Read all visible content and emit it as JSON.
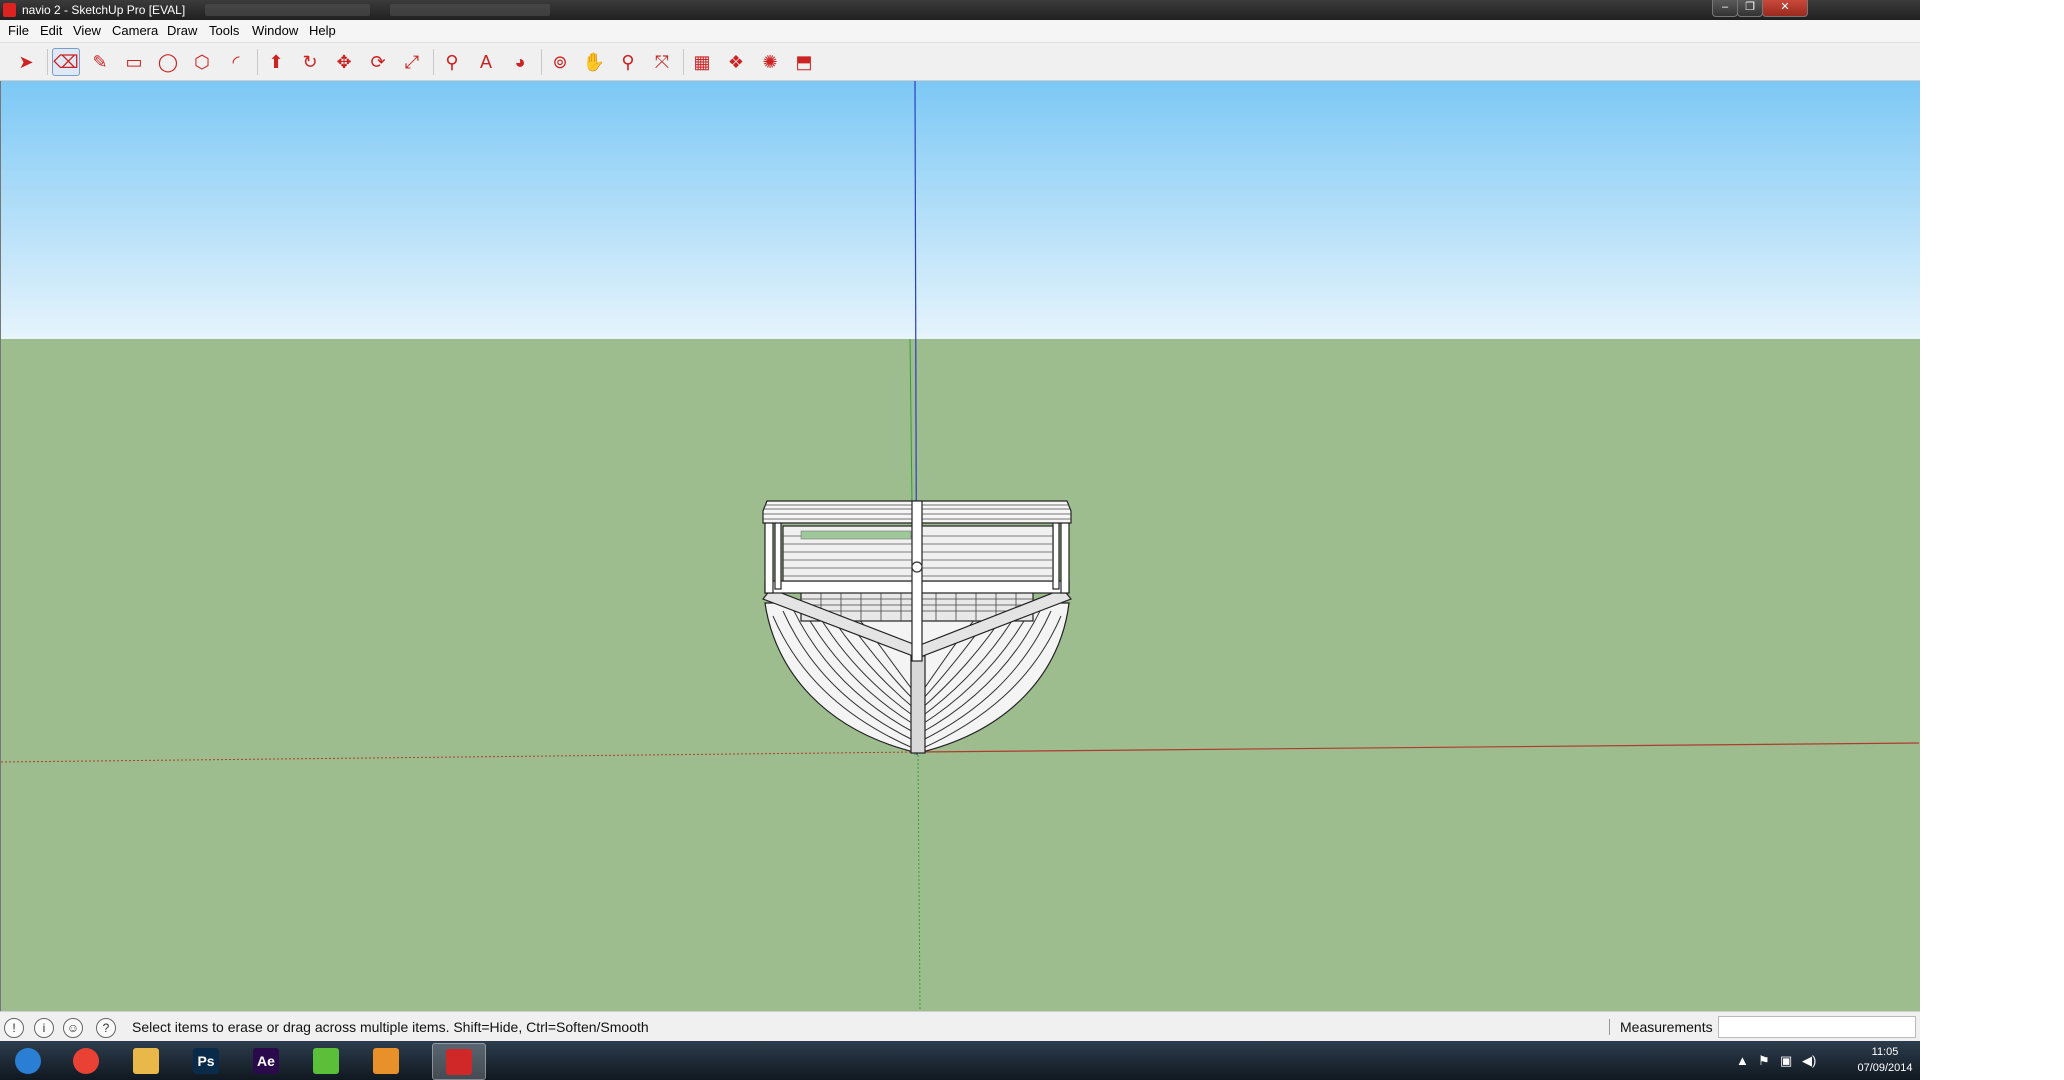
{
  "window": {
    "title": "navio 2 - SketchUp Pro [EVAL]",
    "minimize": "‒",
    "restore": "❐",
    "close": "✕"
  },
  "menu": [
    "File",
    "Edit",
    "View",
    "Camera",
    "Draw",
    "Tools",
    "Window",
    "Help"
  ],
  "toolbar": {
    "tools": [
      {
        "name": "select-tool",
        "icon": "arrow-icon",
        "glyph": "➤",
        "active": false
      },
      {
        "name": "eraser-tool",
        "icon": "eraser-icon",
        "glyph": "⌫",
        "active": true
      },
      {
        "name": "line-tool",
        "icon": "pencil-icon",
        "glyph": "✎",
        "active": false
      },
      {
        "name": "rectangle-tool",
        "icon": "rectangle-icon",
        "glyph": "▭",
        "active": false
      },
      {
        "name": "circle-tool",
        "icon": "circle-icon",
        "glyph": "◯",
        "active": false
      },
      {
        "name": "polygon-tool",
        "icon": "polygon-icon",
        "glyph": "⬡",
        "active": false
      },
      {
        "name": "arc-tool",
        "icon": "arc-icon",
        "glyph": "◜",
        "active": false
      },
      {
        "name": "push-pull-tool",
        "icon": "push-pull-icon",
        "glyph": "⬆",
        "active": false
      },
      {
        "name": "follow-me-tool",
        "icon": "follow-me-icon",
        "glyph": "↻",
        "active": false
      },
      {
        "name": "move-tool",
        "icon": "move-icon",
        "glyph": "✥",
        "active": false
      },
      {
        "name": "rotate-tool",
        "icon": "rotate-icon",
        "glyph": "⟳",
        "active": false
      },
      {
        "name": "scale-tool",
        "icon": "scale-icon",
        "glyph": "⤢",
        "active": false
      },
      {
        "name": "tape-measure-tool",
        "icon": "tape-measure-icon",
        "glyph": "⚲",
        "active": false
      },
      {
        "name": "text-tool",
        "icon": "text-icon",
        "glyph": "A",
        "active": false
      },
      {
        "name": "paint-bucket-tool",
        "icon": "paint-bucket-icon",
        "glyph": "◕",
        "active": false
      },
      {
        "name": "orbit-tool",
        "icon": "orbit-icon",
        "glyph": "⊚",
        "active": false
      },
      {
        "name": "pan-tool",
        "icon": "hand-icon",
        "glyph": "✋",
        "active": false
      },
      {
        "name": "zoom-tool",
        "icon": "magnifier-icon",
        "glyph": "⚲",
        "active": false
      },
      {
        "name": "zoom-extents-tool",
        "icon": "zoom-extents-icon",
        "glyph": "⤧",
        "active": false
      },
      {
        "name": "3d-warehouse-tool",
        "icon": "map-icon",
        "glyph": "▦",
        "active": false
      },
      {
        "name": "get-models-tool",
        "icon": "box-icon",
        "glyph": "❖",
        "active": false
      },
      {
        "name": "share-model-tool",
        "icon": "share-icon",
        "glyph": "✺",
        "active": false
      },
      {
        "name": "extension-warehouse-tool",
        "icon": "extension-icon",
        "glyph": "⬒",
        "active": false
      }
    ]
  },
  "status": {
    "message": "Select items to erase or drag across multiple items. Shift=Hide, Ctrl=Soften/Smooth",
    "measurements_label": "Measurements",
    "measurements_value": "",
    "icons": [
      {
        "name": "geo-location-icon",
        "glyph": "!"
      },
      {
        "name": "credits-icon",
        "glyph": "i"
      },
      {
        "name": "user-icon",
        "glyph": "☺"
      },
      {
        "name": "help-icon",
        "glyph": "?"
      }
    ]
  },
  "taskbar": {
    "apps": [
      {
        "name": "start-button",
        "icon": "windows-logo-icon",
        "label": "",
        "color": "#2a7fd4"
      },
      {
        "name": "taskbar-chrome",
        "icon": "chrome-icon",
        "label": "",
        "color": "#e94235"
      },
      {
        "name": "taskbar-explorer",
        "icon": "folder-icon",
        "label": "",
        "color": "#e8b84a"
      },
      {
        "name": "taskbar-photoshop",
        "icon": "photoshop-icon",
        "label": "Ps",
        "color": "#0a2a4a"
      },
      {
        "name": "taskbar-after-effects",
        "icon": "after-effects-icon",
        "label": "Ae",
        "color": "#2a0a4a"
      },
      {
        "name": "taskbar-app-green",
        "icon": "app-icon",
        "label": "",
        "color": "#5cbf3a"
      },
      {
        "name": "taskbar-media-player",
        "icon": "media-player-icon",
        "label": "",
        "color": "#e8902a"
      },
      {
        "name": "taskbar-sketchup",
        "icon": "sketchup-icon",
        "label": "",
        "color": "#d02828"
      }
    ],
    "clock": {
      "time": "11:05",
      "date": "07/09/2014"
    }
  },
  "colors": {
    "red_axis": "#c0392b",
    "green_axis": "#3a9a3a",
    "blue_axis": "#2a3fbf",
    "ground": "#9dbd8f"
  }
}
